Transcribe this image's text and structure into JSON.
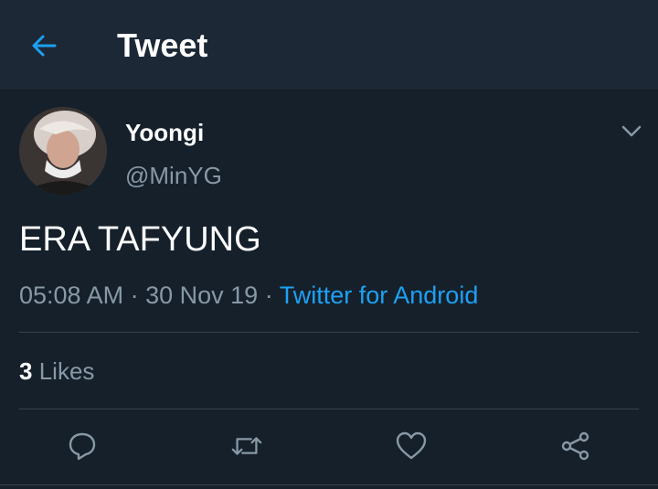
{
  "header": {
    "title": "Tweet",
    "back_icon": "back-arrow-icon"
  },
  "tweet": {
    "display_name": "Yoongi",
    "handle": "@MinYG",
    "text": "ERA TAFYUNG",
    "time": "05:08 AM",
    "date": "30 Nov 19",
    "separator": "·",
    "source": "Twitter for Android",
    "likes_count": "3",
    "likes_label": "Likes"
  },
  "actions": {
    "reply": "reply-icon",
    "retweet": "retweet-icon",
    "like": "heart-icon",
    "share": "share-icon"
  },
  "colors": {
    "background": "#15202b",
    "header": "#1c2836",
    "accent": "#1da1f2",
    "muted": "#8899a6",
    "divider": "#38444d"
  }
}
